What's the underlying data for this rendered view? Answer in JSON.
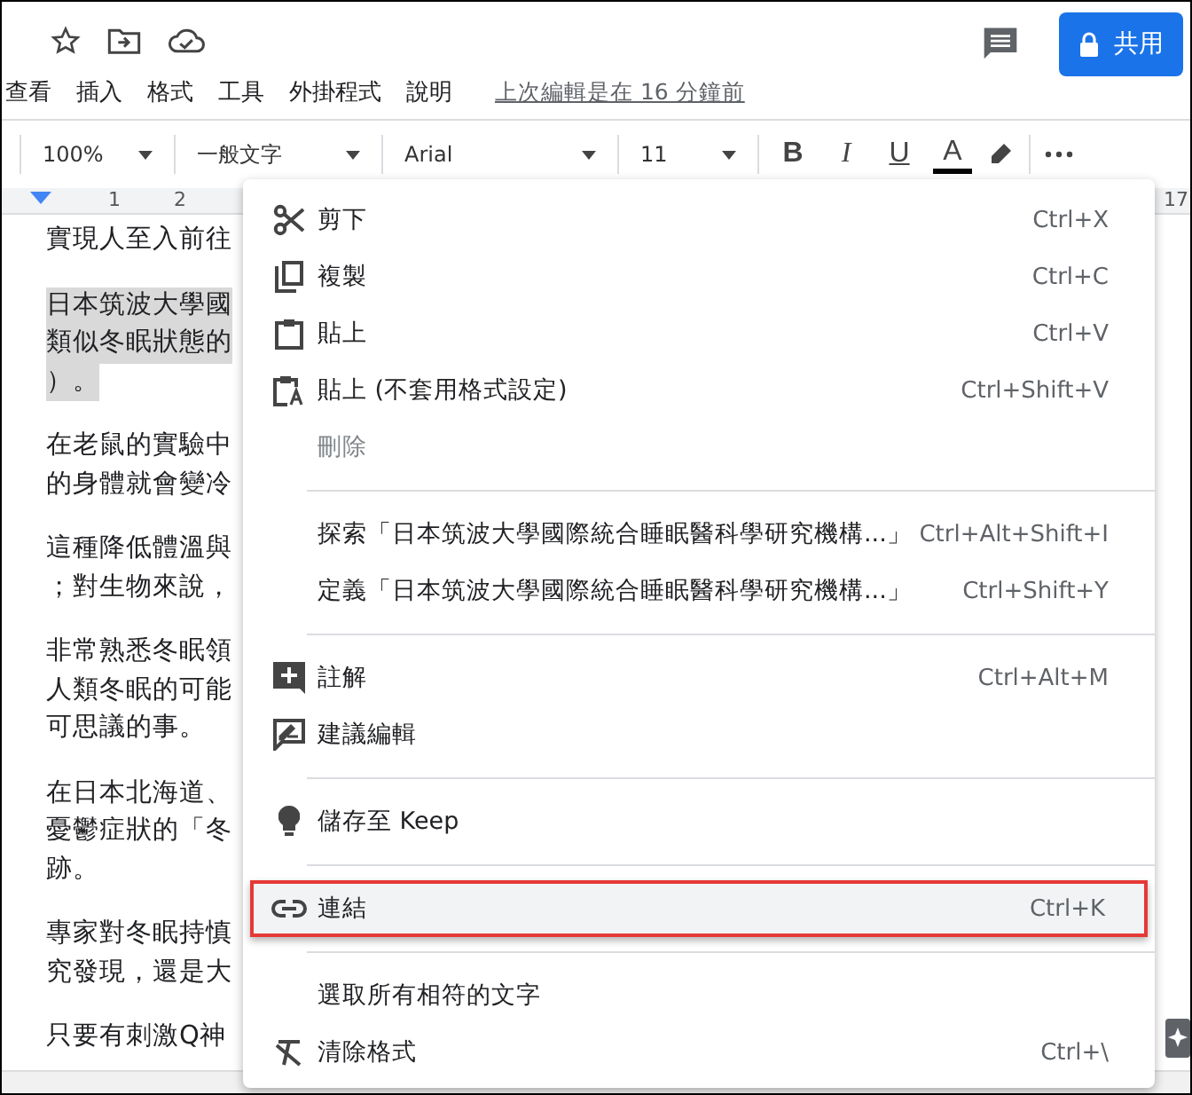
{
  "title_bar": {
    "share_button": "共用"
  },
  "menubar": {
    "items": [
      "查看",
      "插入",
      "格式",
      "工具",
      "外掛程式",
      "說明"
    ],
    "last_edit": "上次編輯是在 16 分鐘前"
  },
  "toolbar": {
    "zoom": "100%",
    "style": "一般文字",
    "font": "Arial",
    "size": "11",
    "format_buttons": [
      "B",
      "I",
      "U",
      "A"
    ]
  },
  "ruler": {
    "marks": [
      "1",
      "2",
      "17"
    ]
  },
  "document": {
    "paragraphs": [
      {
        "selected": false,
        "lines": [
          "實現人至入前往"
        ]
      },
      {
        "selected": true,
        "lines": [
          "日本筑波大學國",
          "類似冬眠狀態的",
          "）。"
        ]
      },
      {
        "selected": false,
        "lines": [
          "在老鼠的實驗中",
          "的身體就會變冷"
        ]
      },
      {
        "selected": false,
        "lines": [
          "這種降低體溫與",
          "；對生物來說，"
        ]
      },
      {
        "selected": false,
        "lines": [
          "非常熟悉冬眠領",
          "人類冬眠的可能",
          "可思議的事。"
        ]
      },
      {
        "selected": false,
        "lines": [
          "在日本北海道、",
          "憂鬱症狀的「冬",
          "跡。"
        ]
      },
      {
        "selected": false,
        "lines": [
          "專家對冬眠持慎",
          "究發現，還是大"
        ]
      },
      {
        "selected": false,
        "lines": [
          "只要有刺激Q神"
        ]
      }
    ]
  },
  "context_menu": {
    "items": [
      {
        "kind": "item",
        "label": "剪下",
        "shortcut": "Ctrl+X",
        "disabled": false,
        "selected": false
      },
      {
        "kind": "item",
        "label": "複製",
        "shortcut": "Ctrl+C",
        "disabled": false,
        "selected": false
      },
      {
        "kind": "item",
        "label": "貼上",
        "shortcut": "Ctrl+V",
        "disabled": false,
        "selected": false
      },
      {
        "kind": "item",
        "label": "貼上 (不套用格式設定)",
        "shortcut": "Ctrl+Shift+V",
        "disabled": false,
        "selected": false
      },
      {
        "kind": "item",
        "label": "刪除",
        "disabled": true,
        "selected": false
      },
      {
        "kind": "separator"
      },
      {
        "kind": "item",
        "label": "探索「日本筑波大學國際統合睡眠醫科學研究機構...」",
        "shortcut": "Ctrl+Alt+Shift+I",
        "disabled": false,
        "selected": false
      },
      {
        "kind": "item",
        "label": "定義「日本筑波大學國際統合睡眠醫科學研究機構...」",
        "shortcut": "Ctrl+Shift+Y",
        "disabled": false,
        "selected": false
      },
      {
        "kind": "separator"
      },
      {
        "kind": "item",
        "label": "註解",
        "shortcut": "Ctrl+Alt+M",
        "disabled": false,
        "selected": false
      },
      {
        "kind": "item",
        "label": "建議編輯",
        "disabled": false,
        "selected": false
      },
      {
        "kind": "separator"
      },
      {
        "kind": "item",
        "label": "儲存至 Keep",
        "disabled": false,
        "selected": false
      },
      {
        "kind": "separator"
      },
      {
        "kind": "item",
        "label": "連結",
        "shortcut": "Ctrl+K",
        "disabled": false,
        "selected": true
      },
      {
        "kind": "separator"
      },
      {
        "kind": "item",
        "label": "選取所有相符的文字",
        "disabled": false,
        "selected": false
      },
      {
        "kind": "item",
        "label": "清除格式",
        "shortcut": "Ctrl+\\",
        "disabled": false,
        "selected": false
      }
    ]
  }
}
